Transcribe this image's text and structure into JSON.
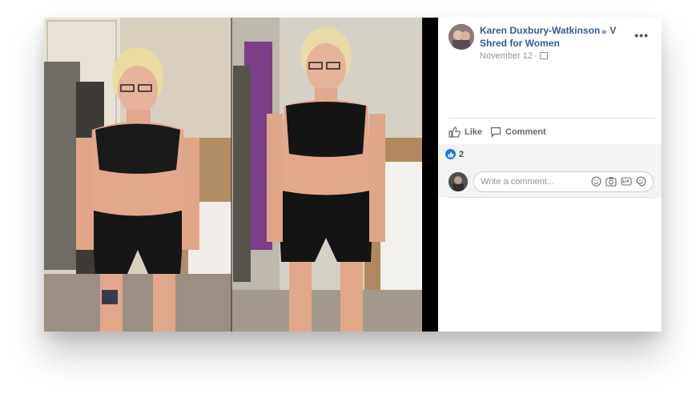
{
  "post": {
    "author": "Karen Duxbury-Watkinson",
    "group": "V Shred for Women",
    "date": "November 12",
    "more_label": "•••"
  },
  "actions": {
    "like_label": "Like",
    "comment_label": "Comment"
  },
  "reactions": {
    "count": "2"
  },
  "comment_box": {
    "placeholder": "Write a comment..."
  },
  "icons": [
    "more-options-icon",
    "privacy-icon",
    "like-thumb-icon",
    "comment-bubble-icon",
    "like-reaction-icon",
    "emoji-icon",
    "camera-icon",
    "gif-icon",
    "sticker-icon"
  ],
  "colors": {
    "link": "#385898",
    "meta": "#90949c",
    "like_blue": "#1877f2",
    "section_bg": "#f2f3f5"
  }
}
